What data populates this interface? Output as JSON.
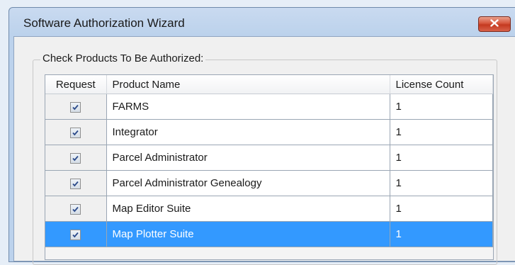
{
  "window": {
    "title": "Software Authorization Wizard",
    "close_icon": "close-icon"
  },
  "group": {
    "legend": "Check Products To Be Authorized:"
  },
  "grid": {
    "columns": [
      "Request",
      "Product Name",
      "License Count"
    ],
    "rows": [
      {
        "checked": true,
        "product": "FARMS",
        "count": "1"
      },
      {
        "checked": true,
        "product": "Integrator",
        "count": "1"
      },
      {
        "checked": true,
        "product": "Parcel Administrator",
        "count": "1"
      },
      {
        "checked": true,
        "product": "Parcel Administrator Genealogy",
        "count": "1"
      },
      {
        "checked": true,
        "product": "Map Editor Suite",
        "count": "1"
      },
      {
        "checked": true,
        "product": "Map Plotter Suite",
        "count": "1",
        "selected": true
      }
    ]
  },
  "colors": {
    "selection": "#3399ff",
    "close_button": "#c43a20"
  }
}
